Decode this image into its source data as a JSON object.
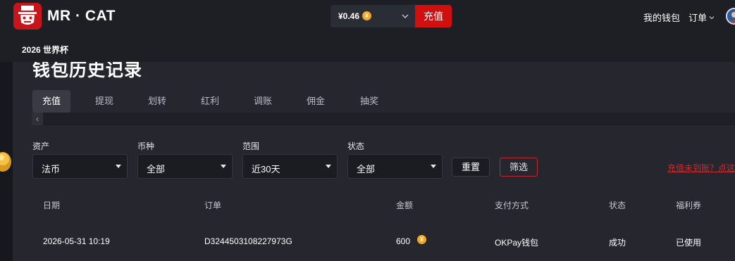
{
  "brand": {
    "name": "MR · CAT",
    "logo": "tophat-cat-logo",
    "logo_color": "#c8151a"
  },
  "header": {
    "balance": "¥0.46",
    "balance_currency_icon": "yen-coin-icon",
    "recharge_label": "充值",
    "wallet_label": "我的钱包",
    "orders_label": "订单",
    "accent_color": "#d10f0f"
  },
  "subnav": {
    "items": [
      {
        "label": "2026 世界杯"
      }
    ]
  },
  "page": {
    "title": "钱包历史记录"
  },
  "tabs": [
    {
      "label": "充值",
      "active": true
    },
    {
      "label": "提现",
      "active": false
    },
    {
      "label": "划转",
      "active": false
    },
    {
      "label": "红利",
      "active": false
    },
    {
      "label": "调账",
      "active": false
    },
    {
      "label": "佣金",
      "active": false
    },
    {
      "label": "抽奖",
      "active": false
    }
  ],
  "filters": {
    "asset": {
      "label": "资产",
      "value": "法币"
    },
    "currency": {
      "label": "币种",
      "value": "全部"
    },
    "range": {
      "label": "范围",
      "value": "近30天"
    },
    "status": {
      "label": "状态",
      "value": "全部"
    },
    "reset_label": "重置",
    "apply_label": "筛选",
    "notice_link": "充值未到账？点这"
  },
  "table": {
    "columns": [
      "日期",
      "订单",
      "金额",
      "支付方式",
      "状态",
      "福利券"
    ],
    "rows": [
      {
        "date": "2026-05-31 10:19",
        "order": "D3244503108227973G",
        "amount": "600",
        "payment": "OKPay钱包",
        "status": "成功",
        "voucher": "已使用"
      }
    ]
  }
}
